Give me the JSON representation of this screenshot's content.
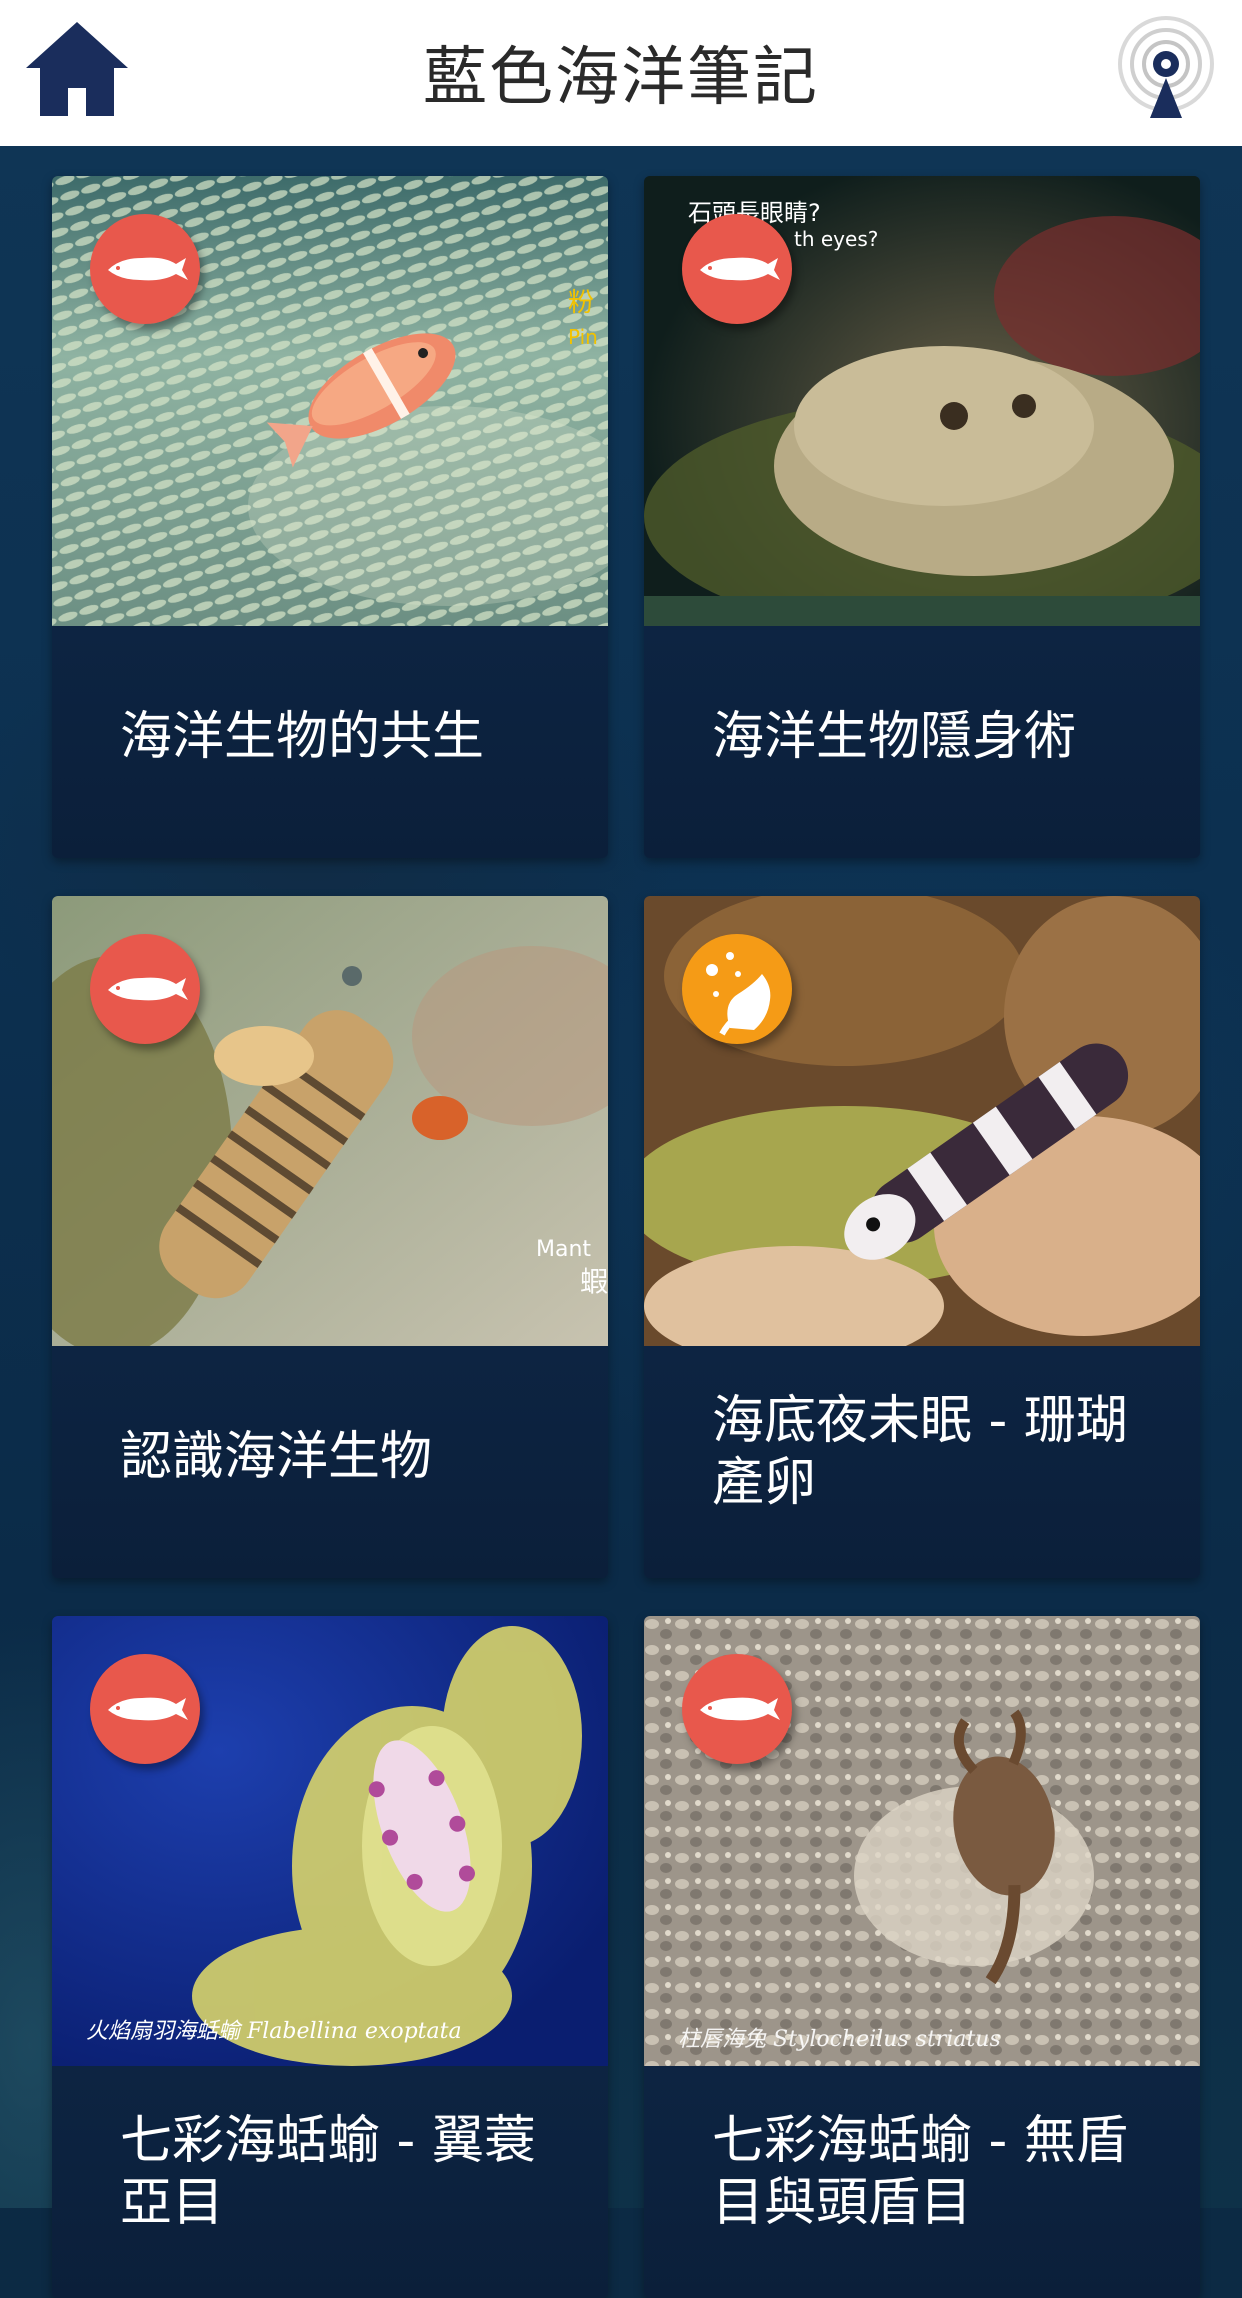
{
  "header": {
    "title": "藍色海洋筆記",
    "home_icon": "home-icon",
    "beacon_icon": "beacon-location-icon"
  },
  "colors": {
    "header_bg": "#ffffff",
    "home_icon": "#1a2d5c",
    "badge_red": "#e8584c",
    "badge_orange": "#f59b16",
    "card_bg": "#0d2240"
  },
  "cards": [
    {
      "title": "海洋生物的共生",
      "badge": "fish-icon",
      "badge_color": "red",
      "thumb_text": "粉\nPin"
    },
    {
      "title": "海洋生物隱身術",
      "badge": "fish-icon",
      "badge_color": "red",
      "thumb_text": "石頭長眼睛?\n    th eyes?"
    },
    {
      "title": "認識海洋生物",
      "badge": "fish-icon",
      "badge_color": "red",
      "thumb_text": "Mant\n蝦"
    },
    {
      "title": "海底夜未眠 - 珊瑚產卵",
      "badge": "coral-spawning-icon",
      "badge_color": "orange",
      "thumb_text": ""
    },
    {
      "title": "七彩海蛞蝓 - 翼蓑亞目",
      "badge": "fish-icon",
      "badge_color": "red",
      "thumb_text": "火焰扇羽海蛞蝓 Flabellina exoptata"
    },
    {
      "title": "七彩海蛞蝓 - 無盾目與頭盾目",
      "badge": "fish-icon",
      "badge_color": "red",
      "thumb_text": "柱唇海兔 Stylocheilus striatus"
    }
  ]
}
